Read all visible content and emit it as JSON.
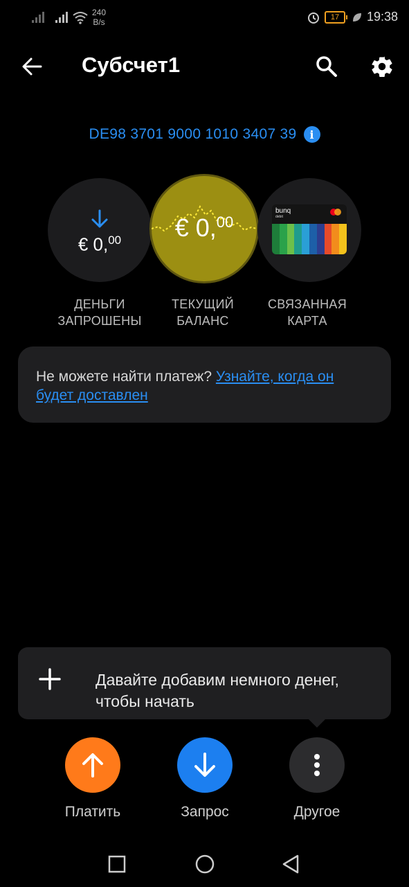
{
  "status_bar": {
    "net_speed_value": "240",
    "net_speed_unit": "B/s",
    "battery": "17",
    "time": "19:38"
  },
  "header": {
    "title": "Субсчет1"
  },
  "iban": "DE98 3701 9000 1010 3407 39",
  "circles": {
    "requested": {
      "currency": "€ 0,",
      "cents": "00",
      "label_line1": "ДЕНЬГИ",
      "label_line2": "ЗАПРОШЕНЫ"
    },
    "balance": {
      "currency": "€ 0,",
      "cents": "00",
      "label_line1": "ТЕКУЩИЙ",
      "label_line2": "БАЛАНС"
    },
    "card": {
      "brand": "bunq",
      "type": "debit",
      "label_line1": "СВЯЗАННАЯ",
      "label_line2": "КАРТА"
    }
  },
  "notice": {
    "text": "Не можете найти платеж? ",
    "link": "Узнайте, когда он будет доставлен "
  },
  "tooltip": {
    "text": "Давайте добавим немного денег, чтобы начать"
  },
  "actions": {
    "pay_label": "Платить",
    "request_label": "Запрос",
    "other_label": "Другое"
  },
  "colors": {
    "accent_blue": "#2a8ef2",
    "pay_orange": "#ff7a1a",
    "balance_olive": "#9c8f12"
  }
}
